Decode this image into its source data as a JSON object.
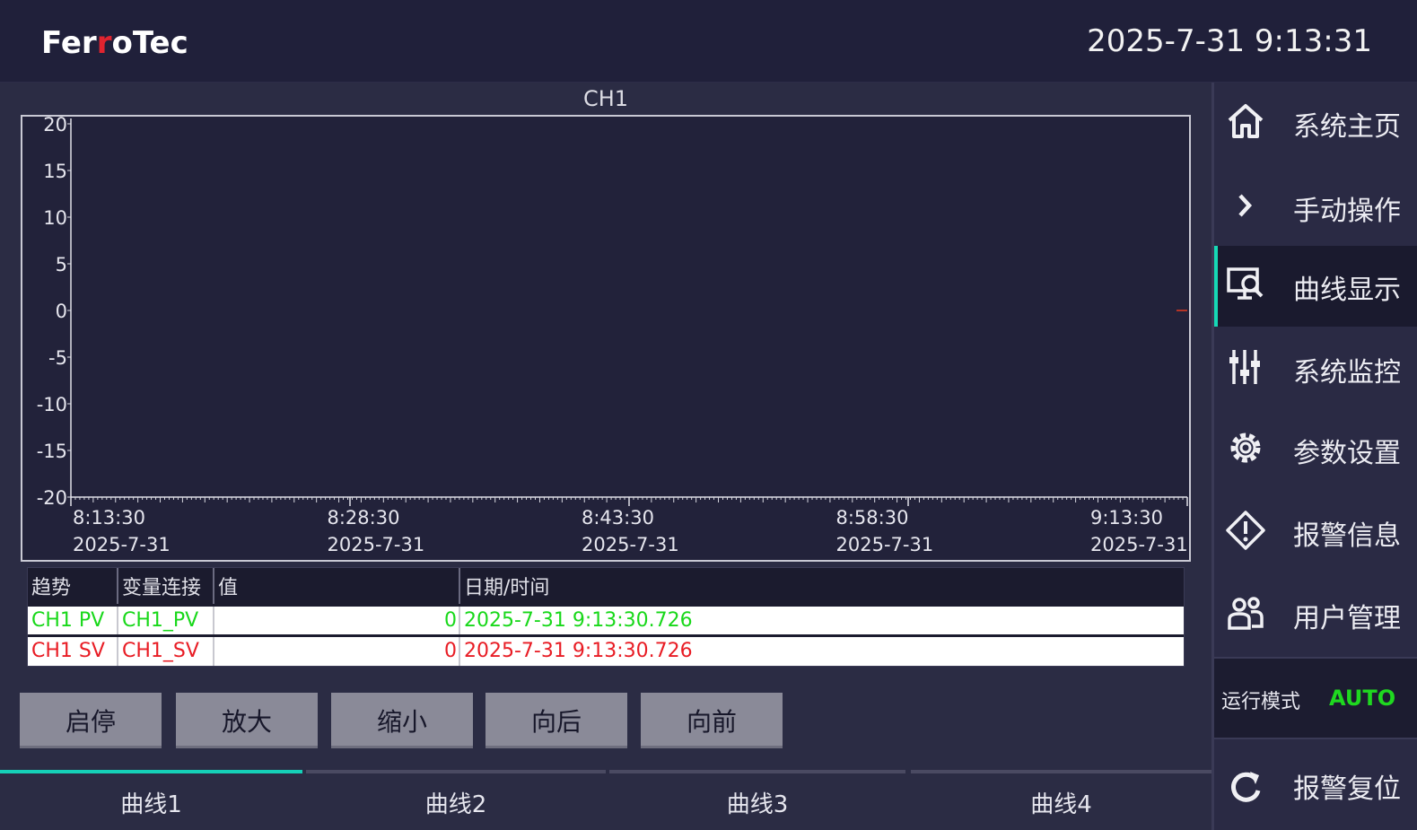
{
  "header": {
    "logo_part1": "Fer",
    "logo_accent": "r",
    "logo_part2": "oTec",
    "datetime": "2025-7-31 9:13:31"
  },
  "chart": {
    "title": "CH1"
  },
  "chart_data": {
    "type": "line",
    "title": "CH1",
    "ylim": [
      -20,
      20
    ],
    "y_ticks": [
      "20",
      "15",
      "10",
      "5",
      "0",
      "-5",
      "-10",
      "-15",
      "-20"
    ],
    "x_ticks": [
      {
        "time": "8:13:30",
        "date": "2025-7-31"
      },
      {
        "time": "8:28:30",
        "date": "2025-7-31"
      },
      {
        "time": "8:43:30",
        "date": "2025-7-31"
      },
      {
        "time": "8:58:30",
        "date": "2025-7-31"
      },
      {
        "time": "9:13:30",
        "date": "2025-7-31"
      }
    ],
    "series": [
      {
        "name": "CH1 PV",
        "color": "#18d81a",
        "points": [
          {
            "x": "9:13:30",
            "y": 0
          }
        ]
      },
      {
        "name": "CH1 SV",
        "color": "#e81c24",
        "points": [
          {
            "x": "9:13:30",
            "y": 0
          }
        ]
      }
    ]
  },
  "legend": {
    "headers": [
      "趋势",
      "变量连接",
      "值",
      "日期/时间"
    ],
    "rows": [
      {
        "trend": "CH1 PV",
        "var": "CH1_PV",
        "value": "0",
        "datetime": "2025-7-31 9:13:30.726",
        "color": "#18d81a"
      },
      {
        "trend": "CH1 SV",
        "var": "CH1_SV",
        "value": "0",
        "datetime": "2025-7-31 9:13:30.726",
        "color": "#e81c24"
      }
    ]
  },
  "buttons": {
    "start_stop": "启停",
    "zoom_in": "放大",
    "zoom_out": "缩小",
    "back": "向后",
    "forward": "向前"
  },
  "tabs": [
    "曲线1",
    "曲线2",
    "曲线3",
    "曲线4"
  ],
  "active_tab": 0,
  "sidebar": {
    "items": [
      {
        "label": "系统主页",
        "icon": "home-icon"
      },
      {
        "label": "手动操作",
        "icon": "chevron-right-icon"
      },
      {
        "label": "曲线显示",
        "icon": "monitor-search-icon"
      },
      {
        "label": "系统监控",
        "icon": "sliders-icon"
      },
      {
        "label": "参数设置",
        "icon": "gear-icon"
      },
      {
        "label": "报警信息",
        "icon": "alert-diamond-icon"
      },
      {
        "label": "用户管理",
        "icon": "users-icon"
      }
    ],
    "active_index": 2,
    "mode_label": "运行模式",
    "mode_value": "AUTO",
    "reset_label": "报警复位",
    "reset_icon": "refresh-icon"
  },
  "colors": {
    "accent": "#16d9b6",
    "pv": "#18d81a",
    "sv": "#e81c24"
  }
}
